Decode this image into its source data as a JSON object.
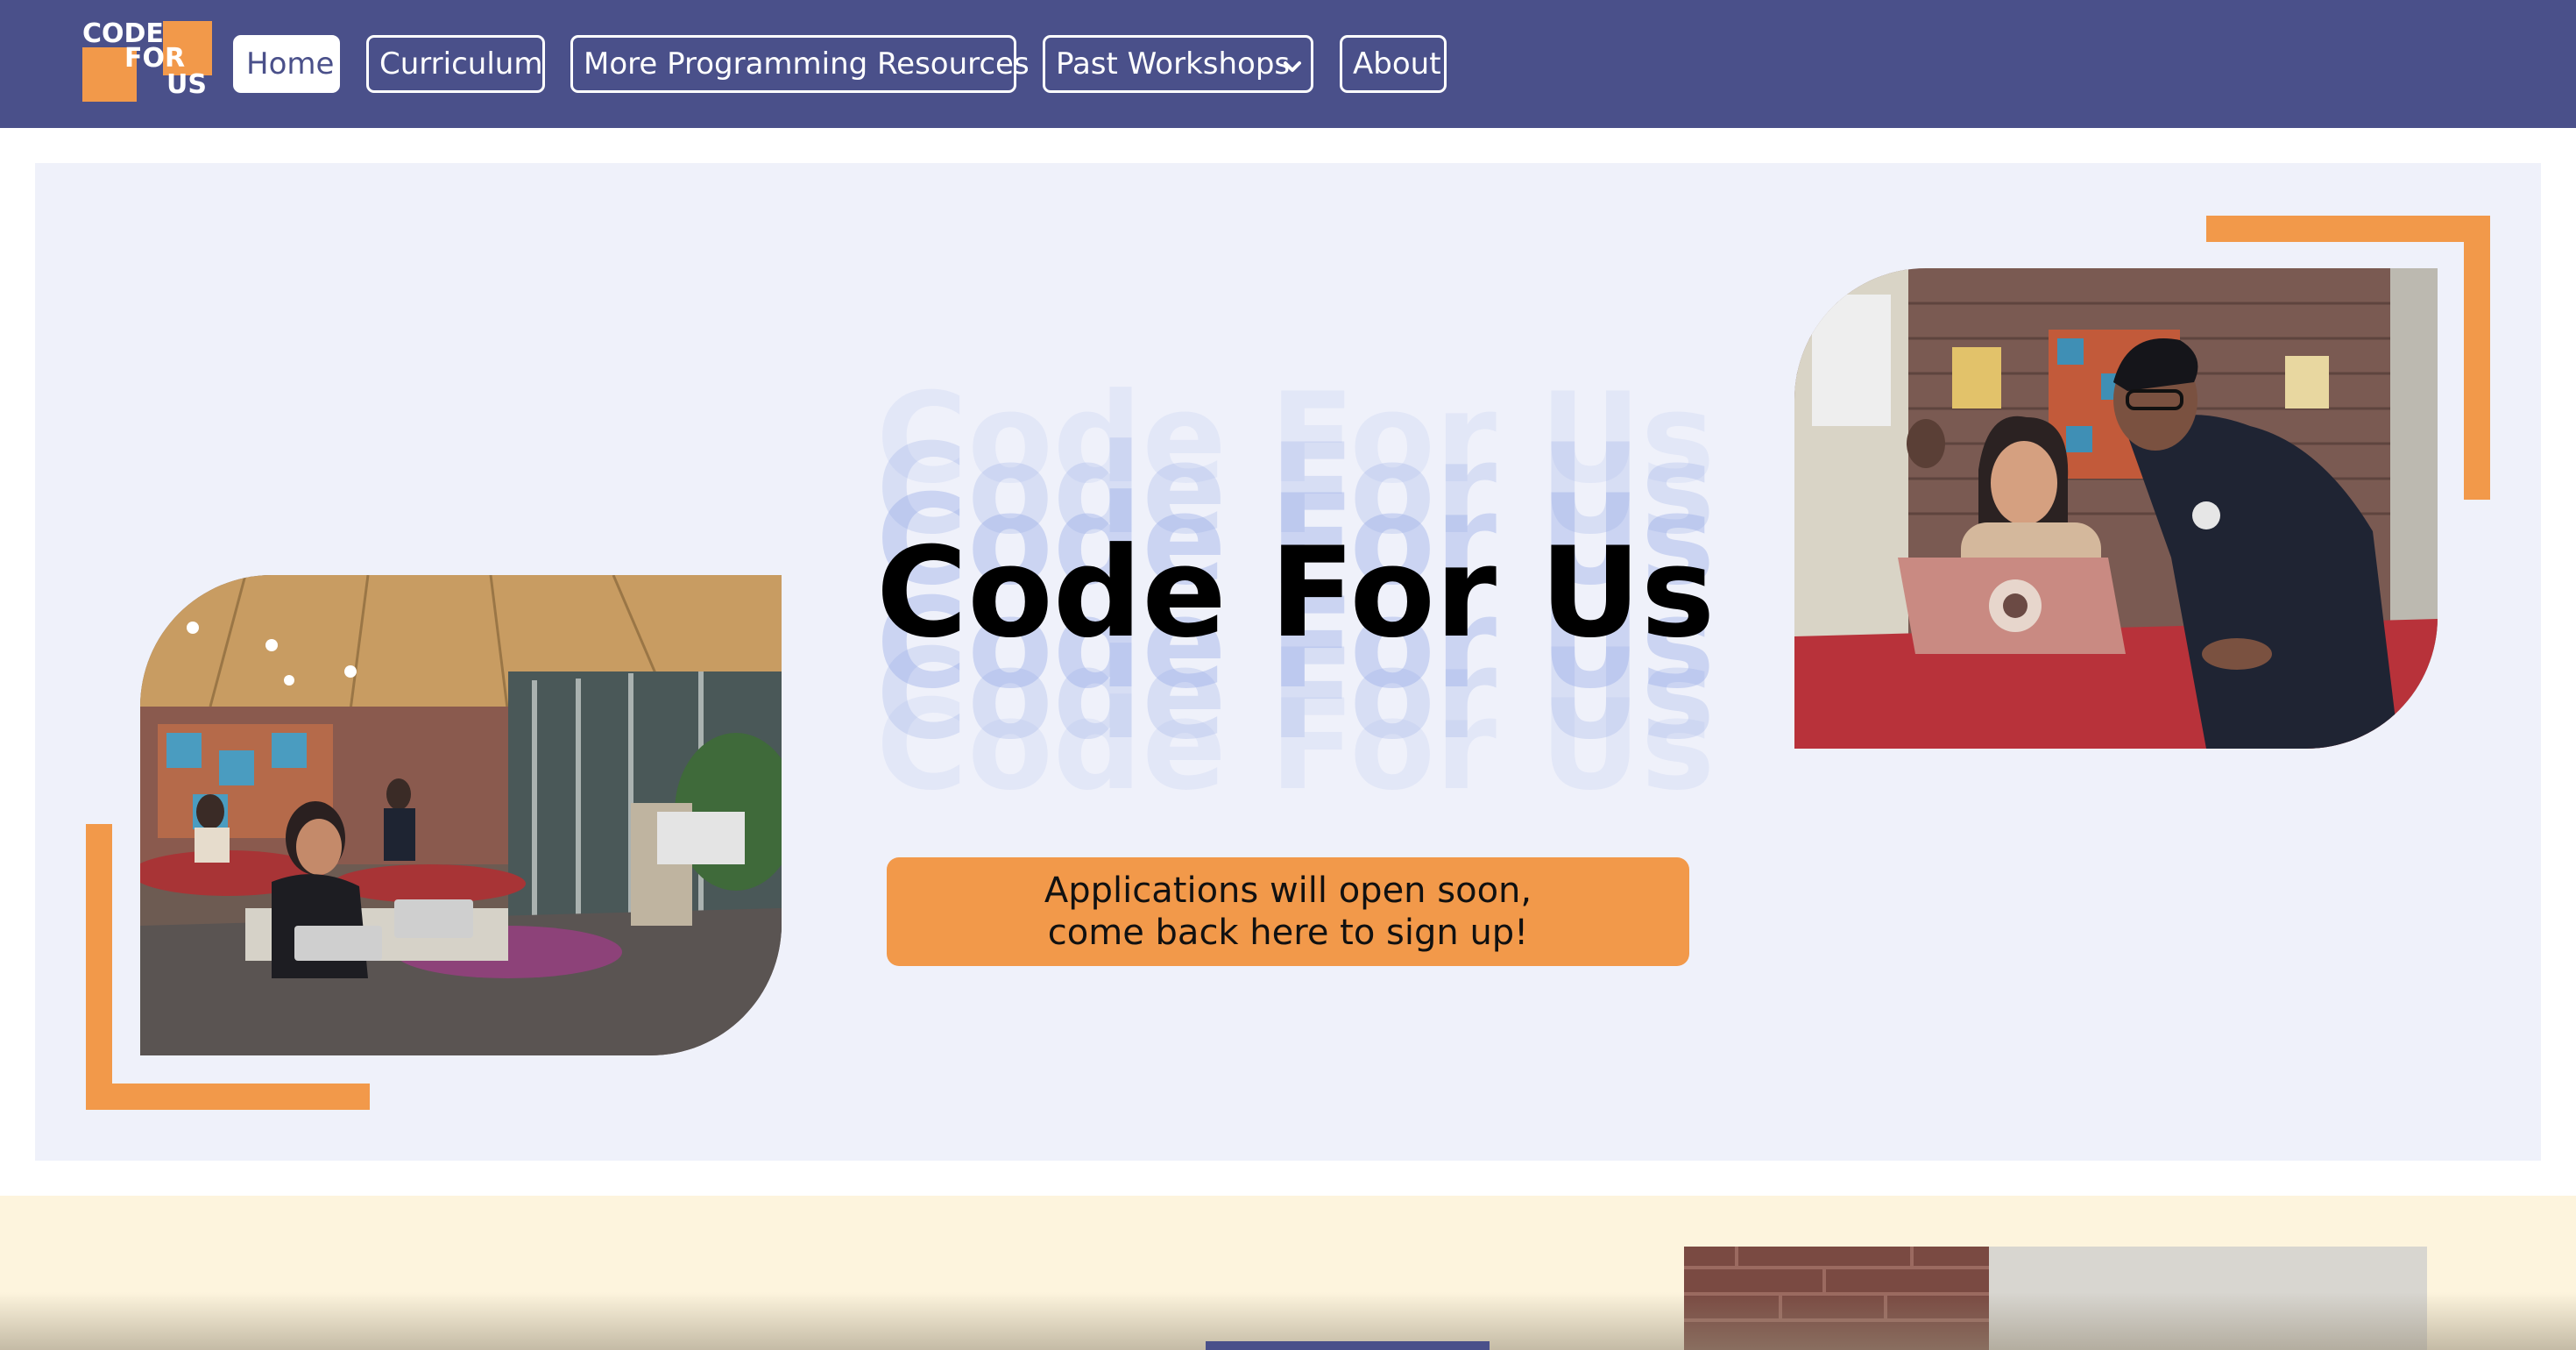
{
  "nav": {
    "logo": {
      "line1": "CODE",
      "line2": "FOR",
      "line3": "US"
    },
    "items": [
      {
        "label": "Home",
        "active": true
      },
      {
        "label": "Curriculum"
      },
      {
        "label": "More Programming Resources"
      },
      {
        "label": "Past Workshops",
        "has_dropdown": true,
        "icon": "chevron-down-icon"
      },
      {
        "label": "About"
      }
    ]
  },
  "hero": {
    "title": "Code For Us",
    "echo_text": "Code For Us",
    "cta": {
      "line1": "Applications will open soon,",
      "line2": "come back here to sign up!"
    }
  },
  "colors": {
    "nav_bg": "#4a508a",
    "accent_orange": "#f2994a",
    "hero_bg": "#eff1fa",
    "echo_blue": "#9aaee8",
    "section2_bg": "#fdf4dd"
  }
}
